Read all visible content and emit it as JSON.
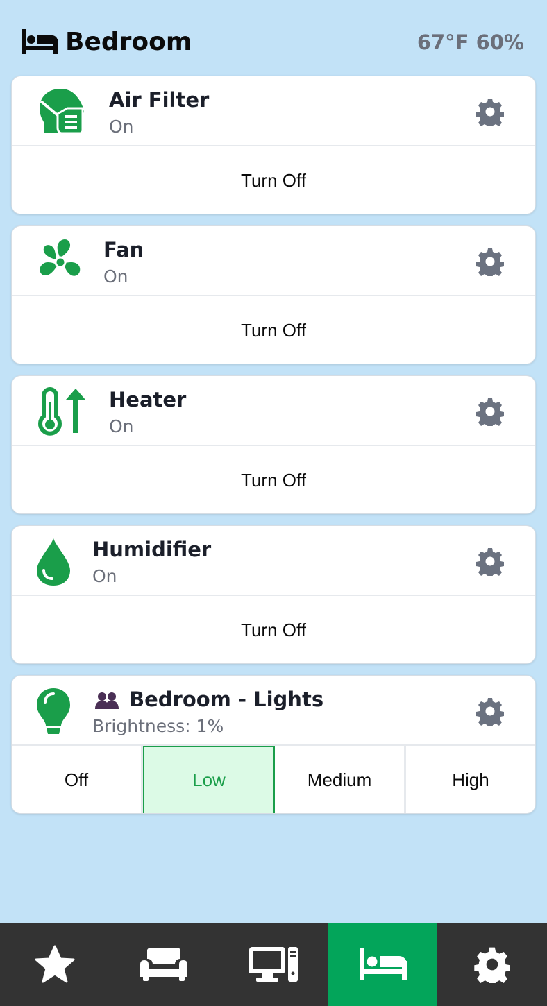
{
  "header": {
    "room_icon": "bed-icon",
    "title": "Bedroom",
    "climate": "67°F 60%"
  },
  "colors": {
    "background": "#c2e2f7",
    "accent_green": "#1a9e4a",
    "nav_background": "#333333",
    "nav_active": "#03a55a",
    "gear_gray": "#6b7280"
  },
  "devices": [
    {
      "icon": "air-filter-mask-icon",
      "name": "Air Filter",
      "status": "On",
      "action_label": "Turn Off"
    },
    {
      "icon": "fan-icon",
      "name": "Fan",
      "status": "On",
      "action_label": "Turn Off"
    },
    {
      "icon": "heater-thermometer-icon",
      "name": "Heater",
      "status": "On",
      "action_label": "Turn Off"
    },
    {
      "icon": "water-drop-icon",
      "name": "Humidifier",
      "status": "On",
      "action_label": "Turn Off"
    }
  ],
  "lights": {
    "icon": "lightbulb-icon",
    "group_icon": "group-users-icon",
    "name": "Bedroom - Lights",
    "status": "Brightness: 1%",
    "options": [
      "Off",
      "Low",
      "Medium",
      "High"
    ],
    "selected": "Low"
  },
  "nav": {
    "tabs": [
      {
        "icon": "star-icon",
        "active": false
      },
      {
        "icon": "couch-icon",
        "active": false
      },
      {
        "icon": "computer-icon",
        "active": false
      },
      {
        "icon": "bed-icon",
        "active": true
      },
      {
        "icon": "gear-icon",
        "active": false
      }
    ]
  }
}
